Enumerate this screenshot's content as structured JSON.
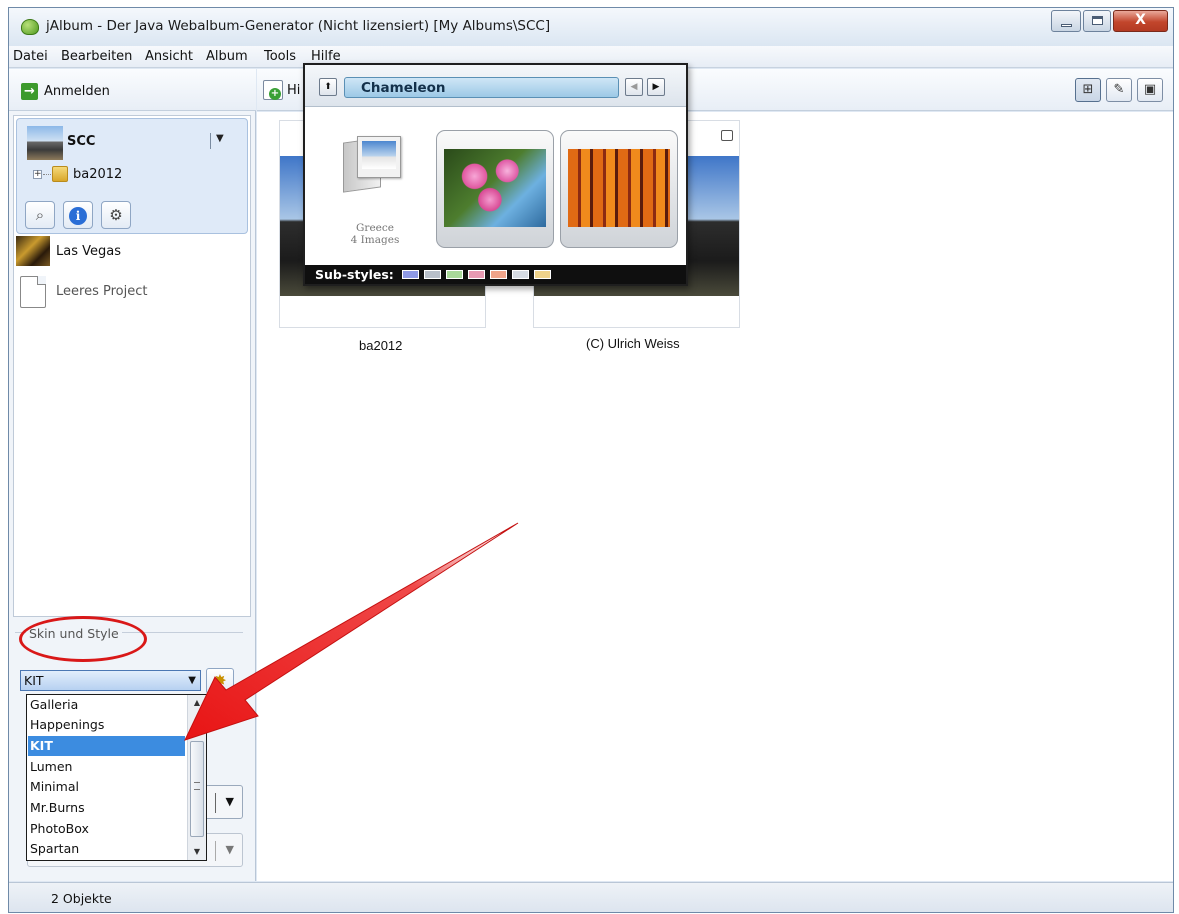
{
  "window": {
    "title": "jAlbum - Der Java Webalbum-Generator (Nicht lizensiert) [My Albums\\SCC]",
    "close_glyph": "X"
  },
  "menu": {
    "items": [
      "Datei",
      "Bearbeiten",
      "Ansicht",
      "Album",
      "Tools",
      "Hilfe"
    ]
  },
  "left": {
    "login_label": "Anmelden",
    "project": {
      "title": "SCC",
      "tree_toggle": "+",
      "folder": "ba2012"
    },
    "projects": [
      {
        "label": "Las Vegas"
      },
      {
        "label": "Leeres Project"
      }
    ],
    "skin_group_title": "Skin und Style",
    "skin_selected": "KIT",
    "skin_options": [
      "Galleria",
      "Happenings",
      "KIT",
      "Lumen",
      "Minimal",
      "Mr.Burns",
      "PhotoBox",
      "Spartan"
    ]
  },
  "toolbar": {
    "add_label": "Hi"
  },
  "main": {
    "thumbs": [
      {
        "label": "ba2012"
      },
      {
        "label": "(C) Ulrich Weiss"
      }
    ]
  },
  "popup": {
    "style_name": "Chameleon",
    "folder_name": "Greece",
    "folder_count": "4 Images",
    "substyles_label": "Sub-styles:",
    "substyle_colors": [
      "#8f9ae6",
      "#b9c0ca",
      "#a9d99a",
      "#e79ab2",
      "#f0a48a",
      "#d6dbe2",
      "#efd28a"
    ]
  },
  "status": {
    "text": "2 Objekte"
  },
  "colors": {
    "annotation_red": "#d91818",
    "selection_blue": "#3c8ce0"
  }
}
